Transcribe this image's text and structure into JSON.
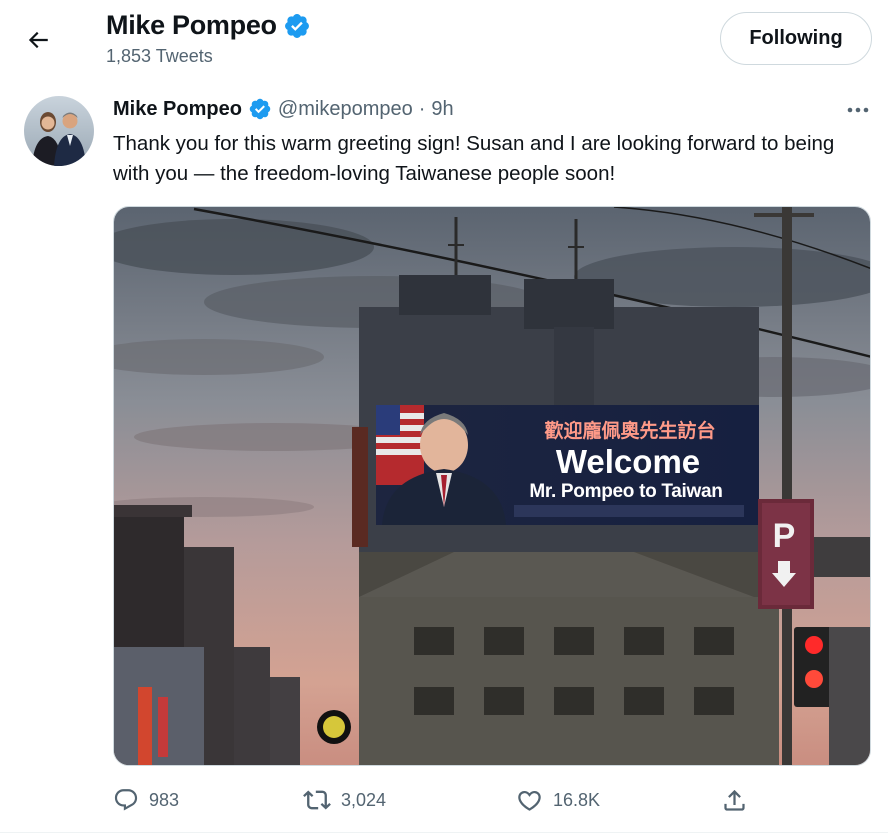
{
  "header": {
    "name": "Mike Pompeo",
    "tweet_count": "1,853 Tweets",
    "follow_label": "Following"
  },
  "tweet": {
    "name": "Mike Pompeo",
    "handle": "@mikepompeo",
    "separator": "·",
    "time": "9h",
    "text": "Thank you for this warm greeting sign!  Susan and I are looking forward to being with you — the freedom-loving Taiwanese people soon!",
    "media": {
      "billboard_heading": "歡迎龐佩奧先生訪台",
      "billboard_welcome": "Welcome",
      "billboard_sub": "Mr. Pompeo to Taiwan",
      "parking_letter": "P"
    },
    "actions": {
      "replies": "983",
      "retweets": "3,024",
      "likes": "16.8K"
    }
  },
  "icons": {
    "back": "arrow-left-icon",
    "verified": "verified-badge-icon",
    "more": "more-dots-icon",
    "reply": "reply-icon",
    "retweet": "retweet-icon",
    "like": "heart-icon",
    "share": "share-icon"
  },
  "colors": {
    "verified_blue": "#1d9bf0",
    "secondary_text": "#536471",
    "primary_text": "#0f1419"
  }
}
